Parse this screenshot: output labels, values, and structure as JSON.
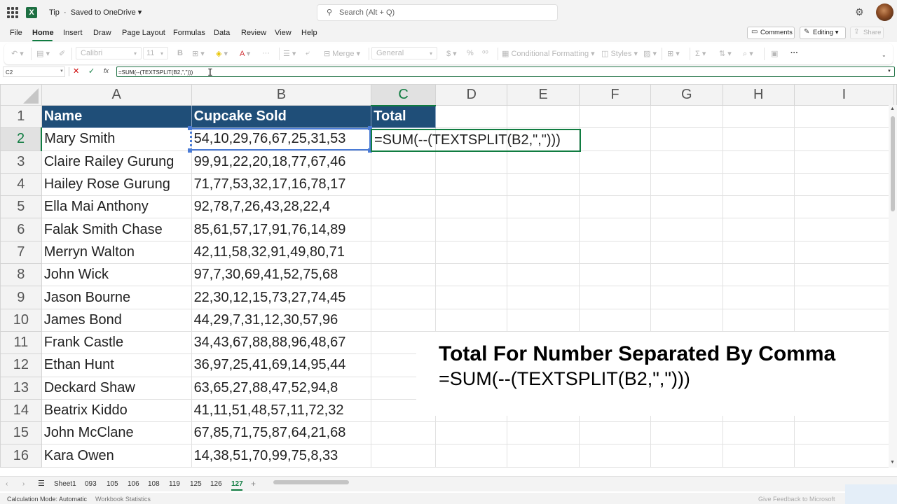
{
  "titlebar": {
    "file_name": "Tip",
    "save_status": "Saved to OneDrive",
    "search_placeholder": "Search (Alt + Q)"
  },
  "menu": {
    "items": [
      "File",
      "Home",
      "Insert",
      "Draw",
      "Page Layout",
      "Formulas",
      "Data",
      "Review",
      "View",
      "Help"
    ],
    "active": "Home",
    "comments_label": "Comments",
    "editing_label": "Editing",
    "share_label": "Share"
  },
  "ribbon": {
    "font_name": "Calibri",
    "font_size": "11",
    "bold": "B",
    "merge_label": "Merge",
    "number_format": "General",
    "currency": "$",
    "conditional_formatting": "Conditional Formatting",
    "styles": "Styles",
    "more": "···"
  },
  "formula_bar": {
    "name_box": "C2",
    "fx": "fx",
    "formula": "=SUM(--(TEXTSPLIT(B2,\",\")))"
  },
  "grid": {
    "columns": [
      "A",
      "B",
      "C",
      "D",
      "E",
      "F",
      "G",
      "H",
      "I"
    ],
    "selected_column": "C",
    "selected_row": "2",
    "header_row": {
      "name": "Name",
      "sold": "Cupcake Sold",
      "total": "Total"
    },
    "rows": [
      {
        "num": "1"
      },
      {
        "num": "2",
        "name": "Mary Smith",
        "sold": "54,10,29,76,67,25,31,53"
      },
      {
        "num": "3",
        "name": "Claire Railey Gurung",
        "sold": "99,91,22,20,18,77,67,46"
      },
      {
        "num": "4",
        "name": "Hailey Rose Gurung",
        "sold": "71,77,53,32,17,16,78,17"
      },
      {
        "num": "5",
        "name": "Ella Mai Anthony",
        "sold": "92,78,7,26,43,28,22,4"
      },
      {
        "num": "6",
        "name": "Falak Smith Chase",
        "sold": "85,61,57,17,91,76,14,89"
      },
      {
        "num": "7",
        "name": "Merryn Walton",
        "sold": "42,11,58,32,91,49,80,71"
      },
      {
        "num": "8",
        "name": "John Wick",
        "sold": "97,7,30,69,41,52,75,68"
      },
      {
        "num": "9",
        "name": "Jason Bourne",
        "sold": "22,30,12,15,73,27,74,45"
      },
      {
        "num": "10",
        "name": "James Bond",
        "sold": "44,29,7,31,12,30,57,96"
      },
      {
        "num": "11",
        "name": "Frank Castle",
        "sold": "34,43,67,88,88,96,48,67"
      },
      {
        "num": "12",
        "name": "Ethan Hunt",
        "sold": "36,97,25,41,69,14,95,44"
      },
      {
        "num": "13",
        "name": "Deckard Shaw",
        "sold": "63,65,27,88,47,52,94,8"
      },
      {
        "num": "14",
        "name": "Beatrix Kiddo",
        "sold": "41,11,51,48,57,11,72,32"
      },
      {
        "num": "15",
        "name": "John McClane",
        "sold": "67,85,71,75,87,64,21,68"
      },
      {
        "num": "16",
        "name": "Kara Owen",
        "sold": "14,38,51,70,99,75,8,33"
      }
    ],
    "editing_text": "=SUM(--(TEXTSPLIT(B2,\",\")))"
  },
  "overlay": {
    "title": "Total For Number Separated By Comma",
    "formula": "=SUM(--(TEXTSPLIT(B2,\",\")))"
  },
  "sheet_tabs": {
    "tabs": [
      "Sheet1",
      "093",
      "105",
      "106",
      "108",
      "119",
      "125",
      "126",
      "127"
    ],
    "active": "127",
    "add": "+"
  },
  "status": {
    "calc_mode": "Calculation Mode: Automatic",
    "workbook_stats": "Workbook Statistics",
    "feedback": "Give Feedback to Microsoft"
  },
  "colors": {
    "accent": "#107c41",
    "header_fill": "#1f4e78",
    "ref_border": "#4a7bd6"
  }
}
